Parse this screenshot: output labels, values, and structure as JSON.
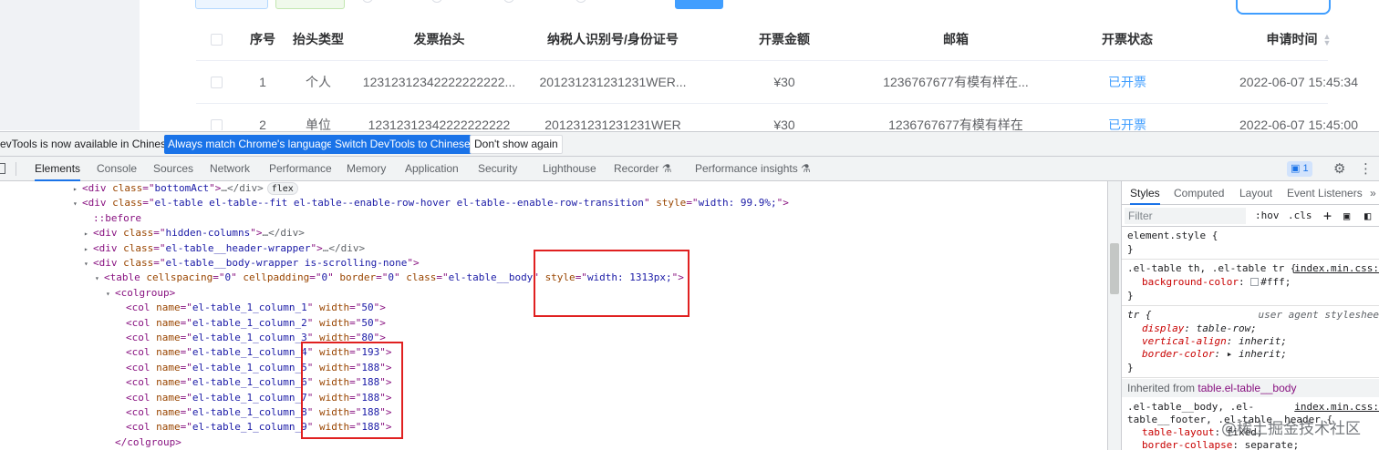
{
  "table": {
    "headers": [
      "序号",
      "抬头类型",
      "发票抬头",
      "纳税人识别号/身份证号",
      "开票金额",
      "邮箱",
      "开票状态",
      "申请时间"
    ],
    "rows": [
      [
        "1",
        "个人",
        "12312312342222222222...",
        "201231231231231WER...",
        "¥30",
        "1236767677有模有样在...",
        "已开票",
        "2022-06-07 15:45:34"
      ],
      [
        "2",
        "单位",
        "12312312342222222222",
        "201231231231231WER",
        "¥30",
        "1236767677有模有样在",
        "已开票",
        "2022-06-07 15:45:00"
      ]
    ]
  },
  "notice": {
    "text": "evTools is now available in Chinese!",
    "btn_match": "Always match Chrome's language",
    "btn_switch": "Switch DevTools to Chinese",
    "btn_dismiss": "Don't show again"
  },
  "devtools_tabs": [
    "Elements",
    "Console",
    "Sources",
    "Network",
    "Performance",
    "Memory",
    "Application",
    "Security",
    "Lighthouse",
    "Recorder ⚗",
    "Performance insights ⚗"
  ],
  "issues_count": "1",
  "dom_lines": [
    {
      "tag": "div",
      "attrs": [
        [
          "class",
          "bottomAct"
        ]
      ],
      "tail": "…</div>",
      "badge": "flex"
    },
    {
      "tag": "div",
      "attrs": [
        [
          "class",
          "el-table el-table--fit el-table--enable-row-hover el-table--enable-row-transition"
        ],
        [
          "style",
          "width: 99.9%;"
        ]
      ],
      "tail": ""
    },
    {
      "text": "::before"
    },
    {
      "tag": "div",
      "attrs": [
        [
          "class",
          "hidden-columns"
        ]
      ],
      "tail": "…</div>"
    },
    {
      "tag": "div",
      "attrs": [
        [
          "class",
          "el-table__header-wrapper"
        ]
      ],
      "tail": "…</div>"
    },
    {
      "tag": "div",
      "attrs": [
        [
          "class",
          "el-table__body-wrapper is-scrolling-none"
        ]
      ],
      "tail": ""
    },
    {
      "tag": "table",
      "attrs": [
        [
          "cellspacing",
          "0"
        ],
        [
          "cellpadding",
          "0"
        ],
        [
          "border",
          "0"
        ],
        [
          "class",
          "el-table__body"
        ],
        [
          "style",
          "width: 1313px;"
        ]
      ],
      "tail": ""
    },
    {
      "tag": "colgroup",
      "attrs": [],
      "tail": ""
    },
    {
      "tag": "col",
      "attrs": [
        [
          "name",
          "el-table_1_column_1"
        ],
        [
          "width",
          "50"
        ]
      ],
      "tail": ""
    },
    {
      "tag": "col",
      "attrs": [
        [
          "name",
          "el-table_1_column_2"
        ],
        [
          "width",
          "50"
        ]
      ],
      "tail": ""
    },
    {
      "tag": "col",
      "attrs": [
        [
          "name",
          "el-table_1_column_3"
        ],
        [
          "width",
          "80"
        ]
      ],
      "tail": ""
    },
    {
      "tag": "col",
      "attrs": [
        [
          "name",
          "el-table_1_column_4"
        ],
        [
          "width",
          "193"
        ]
      ],
      "tail": ""
    },
    {
      "tag": "col",
      "attrs": [
        [
          "name",
          "el-table_1_column_5"
        ],
        [
          "width",
          "188"
        ]
      ],
      "tail": ""
    },
    {
      "tag": "col",
      "attrs": [
        [
          "name",
          "el-table_1_column_6"
        ],
        [
          "width",
          "188"
        ]
      ],
      "tail": ""
    },
    {
      "tag": "col",
      "attrs": [
        [
          "name",
          "el-table_1_column_7"
        ],
        [
          "width",
          "188"
        ]
      ],
      "tail": ""
    },
    {
      "tag": "col",
      "attrs": [
        [
          "name",
          "el-table_1_column_8"
        ],
        [
          "width",
          "188"
        ]
      ],
      "tail": ""
    },
    {
      "tag": "col",
      "attrs": [
        [
          "name",
          "el-table_1_column_9"
        ],
        [
          "width",
          "188"
        ]
      ],
      "tail": ""
    },
    {
      "close": "colgroup"
    }
  ],
  "styles": {
    "tabs": [
      "Styles",
      "Computed",
      "Layout",
      "Event Listeners"
    ],
    "filter_placeholder": "Filter",
    "hov": ":hov",
    "cls": ".cls",
    "element_style": "element.style {",
    "rule1_selector": ".el-table th, .el-table tr {",
    "rule1_source": "index.min.css:",
    "rule1_prop": "background-color",
    "rule1_value": "#fff;",
    "rule2_selector": "tr {",
    "rule2_source": "user agent styleshee",
    "rule2_props": [
      [
        "display",
        "table-row;"
      ],
      [
        "vertical-align",
        "inherit;"
      ],
      [
        "border-color",
        "inherit;"
      ]
    ],
    "inherited_label": "Inherited from ",
    "inherited_selector": "table.el-table__body",
    "rule3_selector_a": ".el-table__body, .el-",
    "rule3_selector_b": "table__footer, .el-table__header {",
    "rule3_source": "index.min.css:",
    "rule3_props": [
      [
        "table-layout",
        "fixed;"
      ],
      [
        "border-collapse",
        "separate;"
      ]
    ],
    "close_brace": "}"
  },
  "watermark": "@稀土掘金技术社区",
  "colors": {
    "accent": "#409eff",
    "highlight": "#e02020",
    "devtools_blue": "#1a73e8"
  }
}
